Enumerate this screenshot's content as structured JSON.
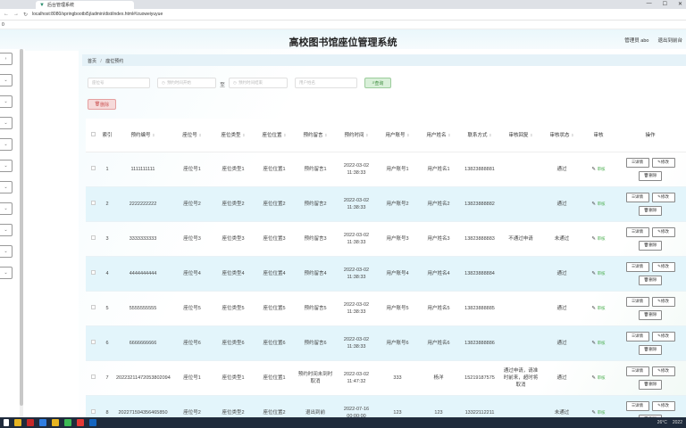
{
  "browser": {
    "tab_title": "后台管理系统",
    "url": "localhost:8080/springbootbi5j/admin/dist/index.html#/zuoweiyuyue",
    "bookmark": "0",
    "win_min": "—",
    "win_max": "☐",
    "win_close": "✕",
    "back": "←",
    "forward": "→",
    "reload": "↻"
  },
  "header": {
    "title": "高校图书馆座位管理系统",
    "user": "管理员 abo",
    "exit": "退出到前台"
  },
  "breadcrumb": {
    "home": "首页",
    "sep": "/",
    "current": "座位预约"
  },
  "search": {
    "zuoweihao_ph": "座位号",
    "start_ph": "预约时间开始",
    "dash": "至",
    "end_ph": "预约时间结束",
    "username_ph": "用户姓名",
    "query_label": "查询"
  },
  "delete_label": "删除",
  "table": {
    "headers": [
      "",
      "索引",
      "预约编号",
      "座位号",
      "座位类型",
      "座位位置",
      "预约留言",
      "预约时间",
      "用户账号",
      "用户姓名",
      "联系方式",
      "审核回复",
      "审核状态",
      "审核",
      "操作"
    ],
    "sort_mark": "⇕",
    "review_label": "审核",
    "detail_label": "详情",
    "edit_label": "修改",
    "del_label": "删除",
    "rows": [
      {
        "idx": "1",
        "bh": "1111111111",
        "zwh": "座位号1",
        "lx": "座位类型1",
        "wz": "座位位置1",
        "ly": "预约留言1",
        "sj": "2022-03-02 11:38:33",
        "zh": "用户账号1",
        "xm": "用户姓名1",
        "tel": "13823888881",
        "hf": "",
        "zt": "通过"
      },
      {
        "idx": "2",
        "bh": "2222222222",
        "zwh": "座位号2",
        "lx": "座位类型2",
        "wz": "座位位置2",
        "ly": "预约留言2",
        "sj": "2022-03-02 11:38:33",
        "zh": "用户账号2",
        "xm": "用户姓名2",
        "tel": "13823888882",
        "hf": "",
        "zt": "通过"
      },
      {
        "idx": "3",
        "bh": "3333333333",
        "zwh": "座位号3",
        "lx": "座位类型3",
        "wz": "座位位置3",
        "ly": "预约留言3",
        "sj": "2022-03-02 11:38:33",
        "zh": "用户账号3",
        "xm": "用户姓名3",
        "tel": "13823888883",
        "hf": "不通过申请",
        "zt": "未通过"
      },
      {
        "idx": "4",
        "bh": "4444444444",
        "zwh": "座位号4",
        "lx": "座位类型4",
        "wz": "座位位置4",
        "ly": "预约留言4",
        "sj": "2022-03-02 11:38:33",
        "zh": "用户账号4",
        "xm": "用户姓名4",
        "tel": "13823888884",
        "hf": "",
        "zt": "通过"
      },
      {
        "idx": "5",
        "bh": "5555555555",
        "zwh": "座位号5",
        "lx": "座位类型5",
        "wz": "座位位置5",
        "ly": "预约留言5",
        "sj": "2022-03-02 11:38:33",
        "zh": "用户账号5",
        "xm": "用户姓名5",
        "tel": "13823888885",
        "hf": "",
        "zt": "通过"
      },
      {
        "idx": "6",
        "bh": "6666666666",
        "zwh": "座位号6",
        "lx": "座位类型6",
        "wz": "座位位置6",
        "ly": "预约留言6",
        "sj": "2022-03-02 11:38:33",
        "zh": "用户账号6",
        "xm": "用户姓名6",
        "tel": "13823888886",
        "hf": "",
        "zt": "通过"
      },
      {
        "idx": "7",
        "bh": "20223211472053802094",
        "zwh": "座位号1",
        "lx": "座位类型1",
        "wz": "座位位置1",
        "ly": "预约时间未到时取消",
        "sj": "2022-03-02 11:47:32",
        "zh": "333",
        "xm": "杨洋",
        "tel": "15219187575",
        "hf": "通过申请，请准时前来，超时将取消",
        "zt": "通过"
      },
      {
        "idx": "8",
        "bh": "202271594356465850",
        "zwh": "座位号2",
        "lx": "座位类型2",
        "wz": "座位位置2",
        "ly": "退出到前",
        "sj": "2022-07-16 00:00:00",
        "zh": "123",
        "xm": "123",
        "tel": "13322112211",
        "hf": "",
        "zt": "未通过"
      }
    ]
  },
  "sidebar_icons": [
    "›",
    "⌄",
    "⌄",
    "⌄",
    "⌄",
    "⌄",
    "⌄",
    "⌄",
    "⌄",
    "⌄",
    "⌄"
  ],
  "taskbar": {
    "weather": "26°C",
    "time": "2022"
  }
}
